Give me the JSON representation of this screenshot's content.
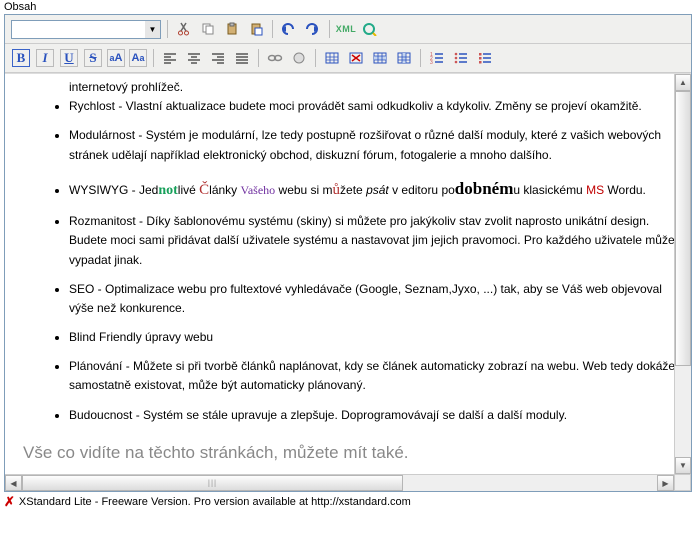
{
  "window_title": "Obsah",
  "toolbar1": {
    "format_select": "",
    "buttons": {
      "cut": "cut-icon",
      "copy": "copy-icon",
      "paste": "paste-icon",
      "paste_word": "paste-word-icon",
      "undo": "undo-icon",
      "redo": "redo-icon",
      "xml_label": "XML",
      "preview": "preview-icon"
    }
  },
  "toolbar2": {
    "bold": "B",
    "italic": "I",
    "underline": "U",
    "strike": "S",
    "sup": "aA",
    "sub": "aA",
    "align_left": "align-left",
    "align_center": "align-center",
    "align_right": "align-right",
    "align_justify": "align-justify",
    "link": "link-icon",
    "unlink": "unlink-icon",
    "table_insert": "table-insert",
    "table_del": "table-del",
    "table_row": "table-row",
    "table_col": "table-col",
    "ol": "ol-icon",
    "ul": "ul-icon",
    "ul2": "ul-icon"
  },
  "content": {
    "line0": "internetový prohlížeč.",
    "items": [
      "Rychlost - Vlastní aktualizace budete moci provádět sami odkudkoliv a kdykoliv. Změny se projeví okamžitě.",
      "Modulárnost - Systém je modulární, lze tedy postupně rozšiřovat o různé další moduly, které z vašich webových stránek udělají například elektronický obchod, diskuzní fórum, fotogalerie a mnoho dalšího.",
      {
        "pre": "WYSIWYG - Jed",
        "not": "not",
        "mid1": "livé ",
        "C": "Č",
        "lanky": "lánky ",
        "vaseho": "Vašeho",
        "mid2": " webu si m",
        "u": "ů",
        "mid3": "žete ",
        "psat": "psát",
        "mid4": " v ed",
        "it": "it",
        "mid5": "oru po",
        "dobnem": "dobném",
        "mid6": "u klasic",
        "kemu": "kému ",
        "ms": "MS",
        "post": " Wordu."
      },
      "Rozmanitost - Díky šablonovému systému (skiny) si můžete pro jakýkoliv stav zvolit naprosto unikátní design. Budete moci sami přidávat další uživatele systému a nastavovat jim jejich pravomoci. Pro každého uživatele může vypadat jinak.",
      "SEO - Optimalizace webu pro fultextové vyhledávače (Google, Seznam,Jyxo, ...) tak, aby se Váš web objevoval výše než konkurence.",
      "Blind Friendly úpravy webu",
      "Plánování - Můžete si při tvorbě článků naplánovat, kdy se článek automaticky zobrazí na webu. Web tedy dokáže samostatně existovat, může být automaticky plánovaný.",
      "Budoucnost - Systém se stále upravuje a zlepšuje. Doprogramovávají se další a další moduly."
    ],
    "heading": "Vše co vidíte na těchto stránkách, můžete mít také."
  },
  "status_bar": "XStandard Lite - Freeware Version.  Pro version available at http://xstandard.com"
}
